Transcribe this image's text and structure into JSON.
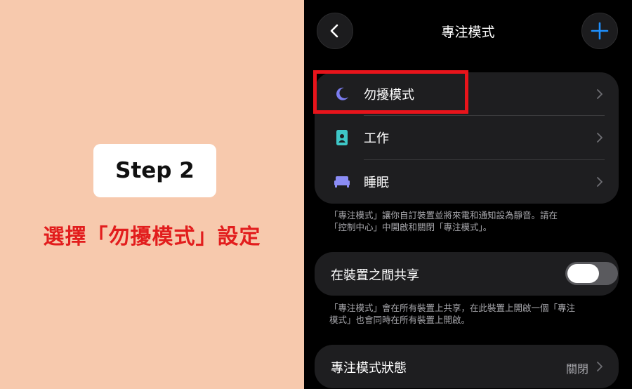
{
  "tutorial": {
    "step_label": "Step 2",
    "instruction": "選擇「勿擾模式」設定"
  },
  "header": {
    "title": "專注模式"
  },
  "focus_modes": [
    {
      "label": "勿擾模式",
      "icon": "moon-icon",
      "color": "#7b7cf0"
    },
    {
      "label": "工作",
      "icon": "id-badge-icon",
      "color": "#3ec7c7"
    },
    {
      "label": "睡眠",
      "icon": "bed-icon",
      "color": "#8b8cf5"
    }
  ],
  "modes_note": [
    "「專注模式」讓你自訂裝置並將來電和通知設為靜音。請在",
    "「控制中心」中開啟和關閉「專注模式」。"
  ],
  "share_setting": {
    "label": "在裝置之間共享",
    "enabled": false,
    "note": [
      "「專注模式」會在所有裝置上共享，在此裝置上開啟一個「專注",
      "模式」也會同時在所有裝置上開啟。"
    ]
  },
  "status": {
    "label": "專注模式狀態",
    "value": "關閉"
  },
  "colors": {
    "highlight": "#e8141b",
    "accent": "#1e90ff",
    "left_background": "#f7c9ad",
    "instruction_text": "#e21d1d"
  }
}
